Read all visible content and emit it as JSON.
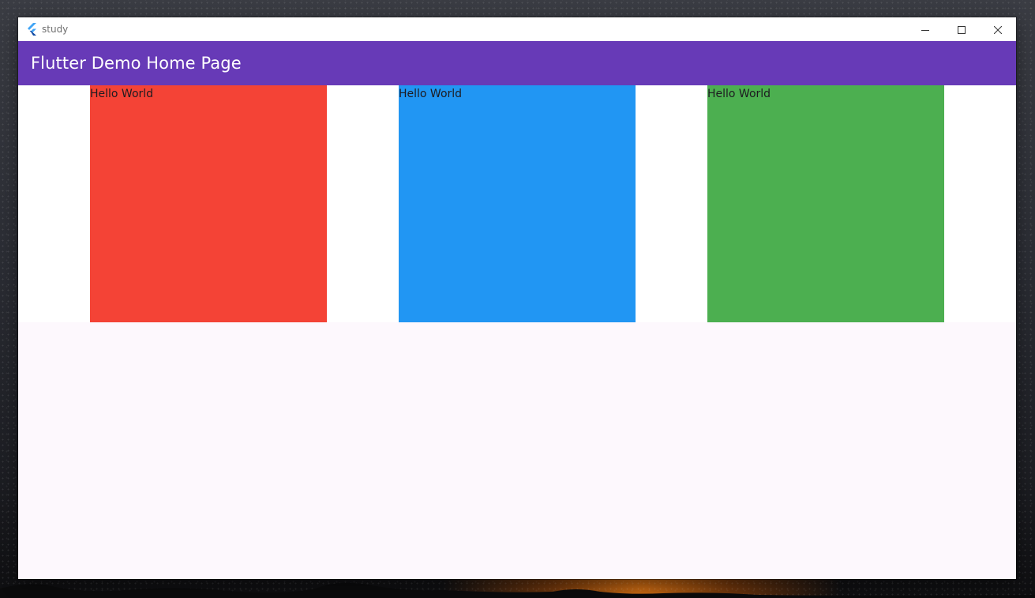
{
  "window": {
    "title": "study"
  },
  "appbar": {
    "title": "Flutter Demo Home Page",
    "color": "#673ab7"
  },
  "icons": {
    "app": "flutter-logo-icon",
    "minimize": "minimize-icon",
    "maximize": "maximize-icon",
    "close": "close-icon"
  },
  "boxes": [
    {
      "label": "Hello World",
      "color": "#f44336"
    },
    {
      "label": "Hello World",
      "color": "#2196f3"
    },
    {
      "label": "Hello World",
      "color": "#4caf50"
    }
  ]
}
